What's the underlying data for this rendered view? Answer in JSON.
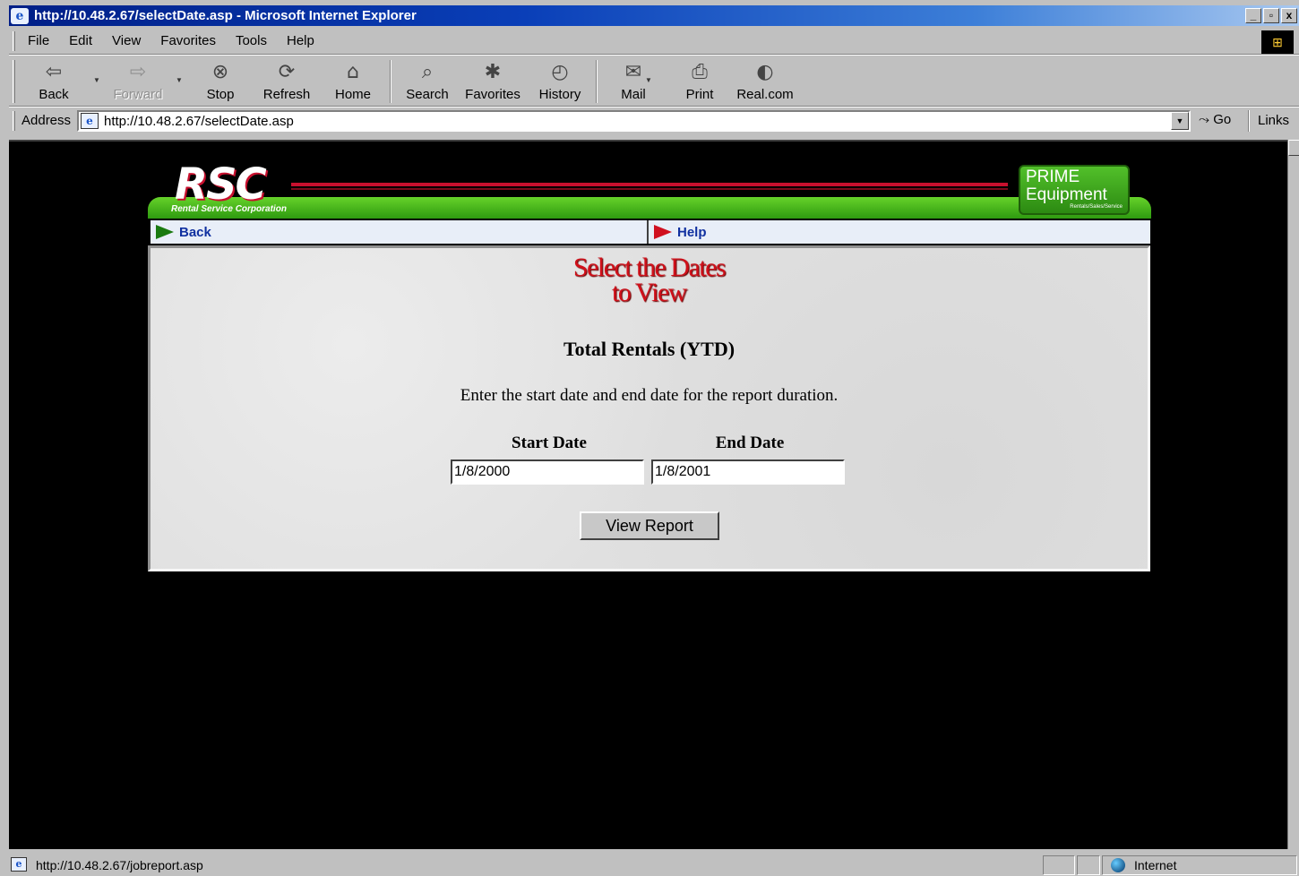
{
  "window": {
    "title": "http://10.48.2.67/selectDate.asp - Microsoft Internet Explorer",
    "controls": [
      "_",
      "▫",
      "x"
    ]
  },
  "menu": [
    "File",
    "Edit",
    "View",
    "Favorites",
    "Tools",
    "Help"
  ],
  "toolbar": {
    "back": "Back",
    "forward": "Forward",
    "stop": "Stop",
    "refresh": "Refresh",
    "home": "Home",
    "search": "Search",
    "favorites": "Favorites",
    "history": "History",
    "mail": "Mail",
    "print": "Print",
    "realcom": "Real.com"
  },
  "address": {
    "label": "Address",
    "url": "http://10.48.2.67/selectDate.asp",
    "go": "Go",
    "links": "Links"
  },
  "banner": {
    "logo": "RSC",
    "logo_sub": "Rental Service Corporation",
    "prime_line1": "PRIME",
    "prime_line2": "Equipment",
    "prime_tagline": "Rentals/Sales/Service"
  },
  "nav": {
    "back": "Back",
    "help": "Help"
  },
  "page": {
    "heading_line1": "Select the Dates",
    "heading_line2": "to View",
    "report_title": "Total Rentals (YTD)",
    "instructions": "Enter the start date and end date for the report duration.",
    "start_label": "Start Date",
    "end_label": "End Date",
    "start_value": "1/8/2000",
    "end_value": "1/8/2001",
    "submit": "View Report"
  },
  "status": {
    "text": "http://10.48.2.67/jobreport.asp",
    "zone": "Internet"
  },
  "icons": {
    "back": "back-arrow-icon",
    "forward": "forward-arrow-icon",
    "stop": "stop-icon",
    "refresh": "refresh-icon",
    "home": "home-icon",
    "search": "search-icon",
    "favorites": "favorites-folder-icon",
    "history": "history-icon",
    "mail": "mail-icon",
    "print": "printer-icon",
    "realcom": "realcom-icon"
  },
  "colors": {
    "titlebar": "#0a3fb8",
    "banner_green": "#3fae18",
    "heading_red": "#d0101a",
    "nav_link": "#1030a0"
  }
}
